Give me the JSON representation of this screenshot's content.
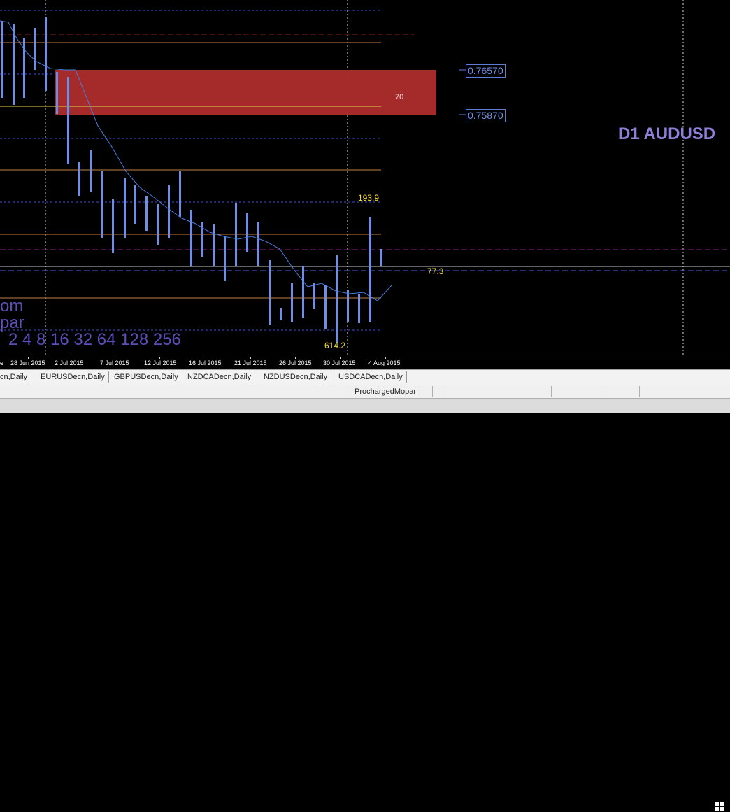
{
  "chart": {
    "title": "D1 AUDUSD",
    "zone_label": "70",
    "price_upper": "0.76570",
    "price_lower": "0.75870",
    "annotation_high": "193.9",
    "annotation_mid": "77.3",
    "annotation_low": "614.2",
    "watermark_line1": "om",
    "watermark_line2": "par",
    "watermark_line3": "2 4 8 16 32 64 128 256",
    "colors": {
      "background": "#000000",
      "candle": "#6e8fe8",
      "ma_line": "#4a7de0",
      "zone_fill": "#a52a2a",
      "level_orange": "#c08040",
      "level_yellow": "#e6d34c",
      "level_blue_dashed": "#3a4fd0",
      "level_red_dashed": "#8b1a1a",
      "level_purple_dashed": "#8b2a8b",
      "annotation_text": "#f2e033",
      "title_color": "#8f7fd8",
      "watermark_color": "#5a4fb8"
    }
  },
  "xaxis": {
    "labels": [
      "28 Jun 2015",
      "2 Jul 2015",
      "7 Jul 2015",
      "12 Jul 2015",
      "16 Jul 2015",
      "21 Jul 2015",
      "26 Jul 2015",
      "30 Jul 2015",
      "4 Aug 2015"
    ]
  },
  "tabs": {
    "items": [
      "cn,Daily",
      "EURUSDecn,Daily",
      "GBPUSDecn,Daily",
      "NZDCADecn,Daily",
      "NZDUSDecn,Daily",
      "USDCADecn,Daily"
    ]
  },
  "status": {
    "profile": "ProchargedMopar"
  }
}
